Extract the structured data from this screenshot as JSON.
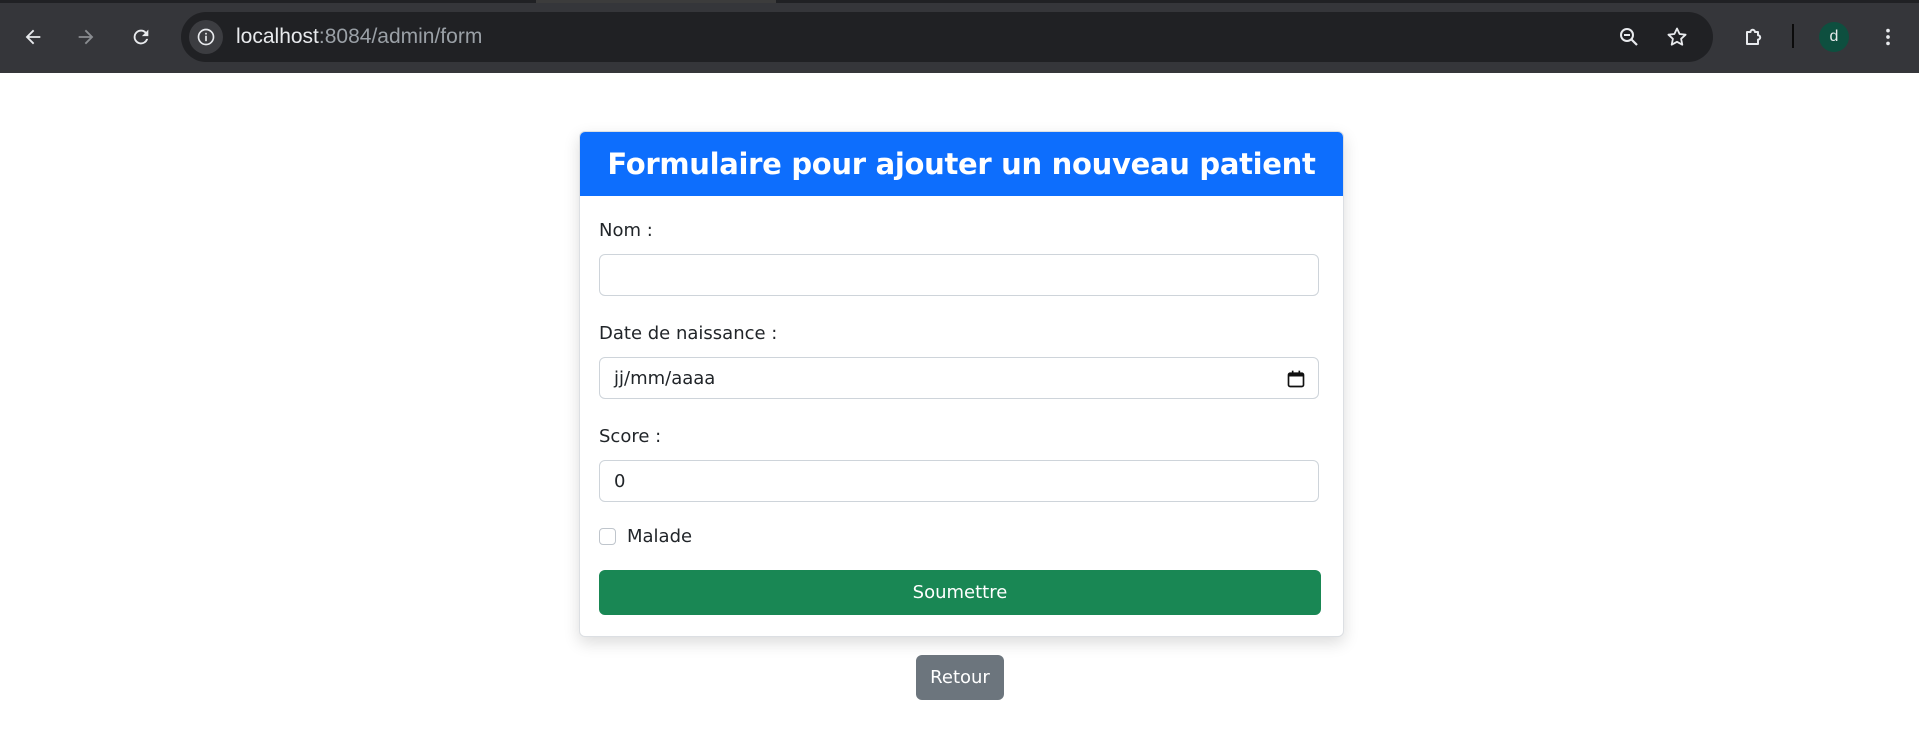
{
  "browser": {
    "url_host": "localhost",
    "url_path": ":8084/admin/form",
    "profile_initial": "d",
    "icons": [
      "back-arrow-icon",
      "forward-arrow-icon",
      "reload-icon",
      "site-info-icon",
      "zoom-out-icon",
      "star-icon",
      "extensions-icon",
      "more-vert-icon"
    ]
  },
  "form": {
    "title": "Formulaire pour ajouter un nouveau patient",
    "nom_label": "Nom :",
    "nom_value": "",
    "date_label": "Date de naissance :",
    "date_placeholder": "jj/mm/aaaa",
    "score_label": "Score :",
    "score_value": "0",
    "malade_label": "Malade",
    "malade_checked": false,
    "submit_label": "Soumettre"
  },
  "back_label": "Retour",
  "colors": {
    "header": "#0d6efd",
    "submit": "#198754",
    "back": "#6c757d",
    "chrome": "#35363a"
  }
}
